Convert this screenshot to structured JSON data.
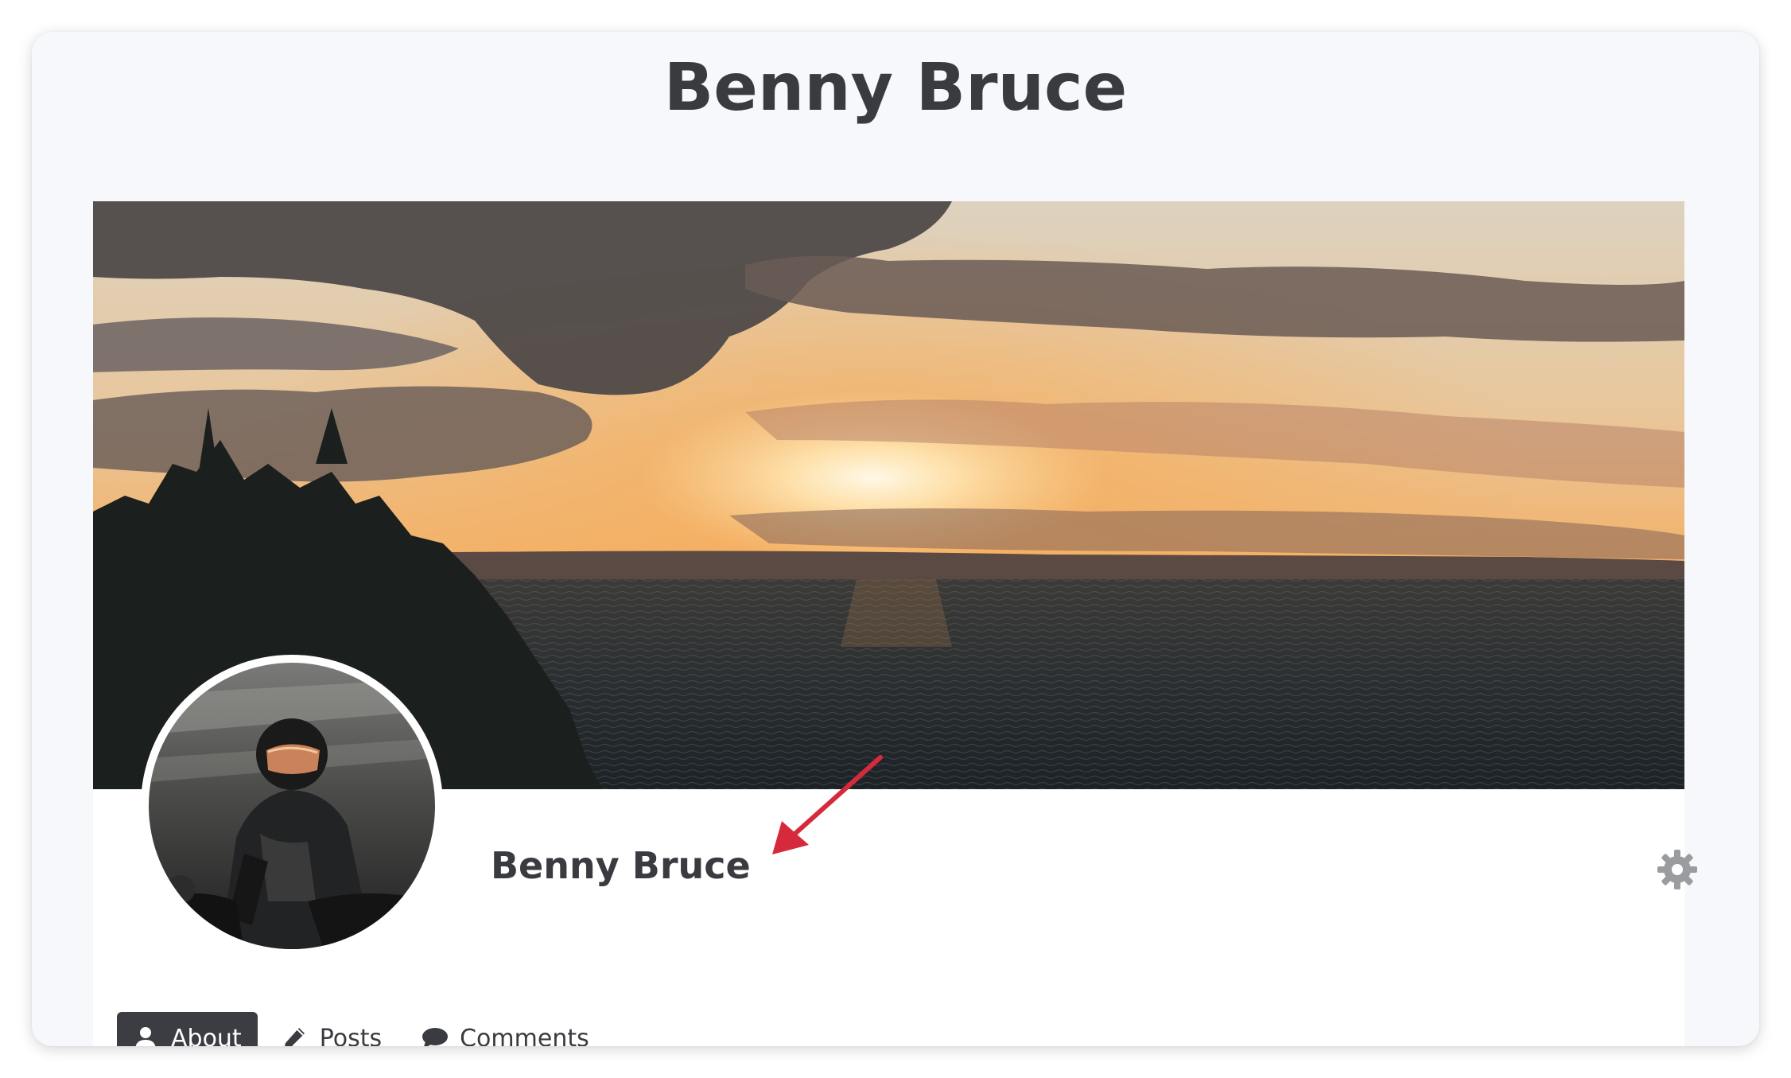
{
  "page": {
    "title": "Benny Bruce"
  },
  "profile": {
    "name": "Benny Bruce",
    "cover_image": "sunset-over-sea-photo",
    "avatar_image": "motorcyclist-in-helmet-photo",
    "settings_icon": "gear-icon"
  },
  "tabs": [
    {
      "label": "About",
      "icon": "user-icon",
      "active": true
    },
    {
      "label": "Posts",
      "icon": "pencil-icon",
      "active": false
    },
    {
      "label": "Comments",
      "icon": "comment-icon",
      "active": false
    }
  ],
  "colors": {
    "text": "#3a3b40",
    "active_tab_bg": "#3b3d42",
    "annotation_arrow": "#d62a3c",
    "card_bg": "#f7f8fb"
  }
}
